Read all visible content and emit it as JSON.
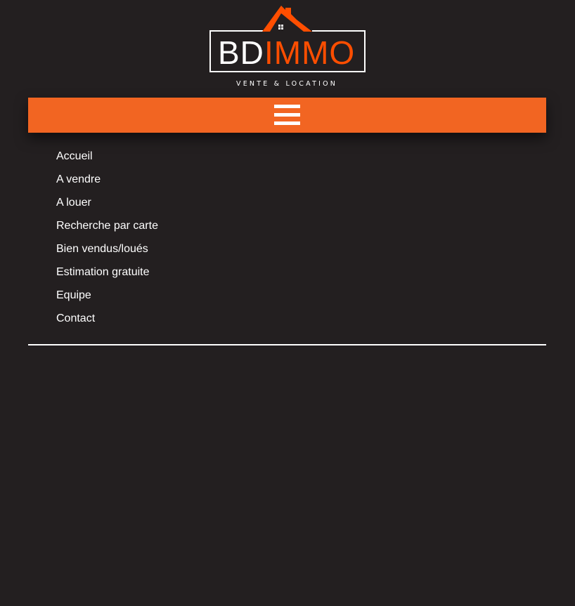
{
  "logo": {
    "text_left": "BD",
    "text_right": "IMMO",
    "tagline": "VENTE & LOCATION",
    "colors": {
      "brand_orange": "#f26522",
      "logo_roof": "#ff4e00",
      "text_white": "#ffffff"
    }
  },
  "nav": {
    "menu_icon": "hamburger-menu-icon",
    "bar_color": "#f26522",
    "items": [
      {
        "label": "Accueil"
      },
      {
        "label": "A vendre"
      },
      {
        "label": "A louer"
      },
      {
        "label": "Recherche par carte"
      },
      {
        "label": "Bien vendus/loués"
      },
      {
        "label": "Estimation gratuite"
      },
      {
        "label": "Equipe"
      },
      {
        "label": "Contact"
      }
    ]
  },
  "page": {
    "background_color": "#231f20"
  }
}
